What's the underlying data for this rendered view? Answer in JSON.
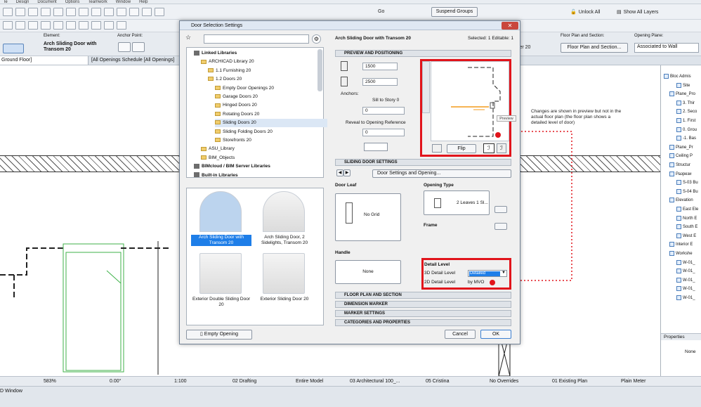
{
  "menubar": {
    "items": [
      "le",
      "Design",
      "Document",
      "Options",
      "Teamwork",
      "Window",
      "Help"
    ]
  },
  "toolbar": {
    "suspend_groups": "Suspend Groups",
    "go": "Go",
    "unlock_all": "Unlock All",
    "show_all_layers": "Show All Layers"
  },
  "infobox": {
    "element_label": "Element:",
    "element_value": "Arch Sliding Door with Transom 20",
    "anchor_label": "Anchor Point:",
    "fp_label": "Floor Plan and Section:",
    "fp_value": "Floor Plan and Section...",
    "fp_prefix": "ker 20",
    "opening_label": "Opening Plane:",
    "opening_value": "Associated to Wall"
  },
  "tabs": {
    "ground_floor": "Ground Floor]",
    "schedule": "[All Openings Schedule [All Openings]"
  },
  "dialog": {
    "title": "Door Selection Settings",
    "element_name": "Arch Sliding Door with Transom 20",
    "selected": "Selected: 1 Editable: 1",
    "tree": [
      {
        "label": "Linked Libraries",
        "level": 0,
        "type": "lib"
      },
      {
        "label": "ARCHICAD Library 20",
        "level": 1,
        "type": "folder"
      },
      {
        "label": "1.1 Furnishing 20",
        "level": 2,
        "type": "folder"
      },
      {
        "label": "1.2 Doors 20",
        "level": 2,
        "type": "folder"
      },
      {
        "label": "Empty Door Openings 20",
        "level": 3,
        "type": "folder"
      },
      {
        "label": "Garage Doors 20",
        "level": 3,
        "type": "folder"
      },
      {
        "label": "Hinged Doors 20",
        "level": 3,
        "type": "folder"
      },
      {
        "label": "Rotating Doors 20",
        "level": 3,
        "type": "folder"
      },
      {
        "label": "Sliding Doors 20",
        "level": 3,
        "type": "folder",
        "selected": true
      },
      {
        "label": "Sliding Folding Doors 20",
        "level": 3,
        "type": "folder"
      },
      {
        "label": "Storefronts 20",
        "level": 3,
        "type": "folder"
      },
      {
        "label": "ASU_Library",
        "level": 1,
        "type": "folder"
      },
      {
        "label": "BIM_Objects",
        "level": 1,
        "type": "folder"
      },
      {
        "label": "BIMcloud / BIM Server Libraries",
        "level": 0,
        "type": "lib"
      },
      {
        "label": "Built-in Libraries",
        "level": 0,
        "type": "lib"
      }
    ],
    "thumbs": [
      {
        "label": "Arch Sliding Door with Transom 20",
        "selected": true
      },
      {
        "label": "Arch Sliding Door, 2 Sidelights, Transom 20",
        "selected": false
      },
      {
        "label": "Exterior Double Sliding Door 20",
        "selected": false
      },
      {
        "label": "Exterior Sliding Door 20",
        "selected": false
      }
    ],
    "empty_opening": "Empty Opening",
    "preview_section": "PREVIEW AND POSITIONING",
    "width": "1500",
    "height": "2500",
    "anchors_label": "Anchors:",
    "sill_label": "Sill to Story 0",
    "sill_value": "0",
    "reveal_label": "Reveal to Opening Reference",
    "reveal_value": "0",
    "flip": "Flip",
    "preview_tooltip": "Preview",
    "sliding_section": "SLIDING DOOR SETTINGS",
    "settings_dropdown": "Door Settings and Opening...",
    "door_leaf": "Door Leaf",
    "no_grid": "No Grid",
    "opening_type": "Opening Type",
    "opening_value": "2 Leaves 1 Sl...",
    "frame": "Frame",
    "handle": "Handle",
    "handle_value": "None",
    "detail_level": "Detail Level",
    "detail_3d_label": "3D Detail Level",
    "detail_3d_value": "Detailed",
    "detail_2d_label": "2D Detail Level",
    "detail_2d_value": "by MVO",
    "collapsed": [
      "FLOOR PLAN AND SECTION",
      "DIMENSION MARKER",
      "MARKER SETTINGS",
      "CATEGORIES AND PROPERTIES"
    ],
    "cancel": "Cancel",
    "ok": "OK"
  },
  "annotation": "Changes are shown in preview but not in the actual floor plan (the floor plan shows a detailed level of door)",
  "navigator": {
    "items": [
      "Bloc Admis",
      "Site",
      "Plane_Pro",
      "3. Thir",
      "2. Seco",
      "1. First",
      "0. Grou",
      "-1. Bas",
      "Plane_Pr",
      "Ceiling P",
      "Structur",
      "Разрези",
      "S-03 Bu",
      "S-04 Bu",
      "Elevation",
      "East Ele",
      "North E",
      "South E",
      "West E",
      "Interior E",
      "Workshe",
      "W-01_",
      "W-01_",
      "W-01_",
      "W-01_",
      "W-01_"
    ],
    "properties_label": "Properties",
    "properties_value": "None"
  },
  "statusbar": {
    "zoom": "583%",
    "angle": "0.00°",
    "scale": "1:100",
    "layer": "02 Drafting",
    "model": "Entire Model",
    "pen": "03 Architectural 100_...",
    "user": "05 Cristina",
    "override": "No Overrides",
    "renov": "01 Existing Plan",
    "dim": "Plain Meter"
  },
  "bottom": {
    "window_label": "D Window"
  },
  "colors": {
    "accent_red": "#e1141b",
    "selection_blue": "#1e7ee8"
  }
}
